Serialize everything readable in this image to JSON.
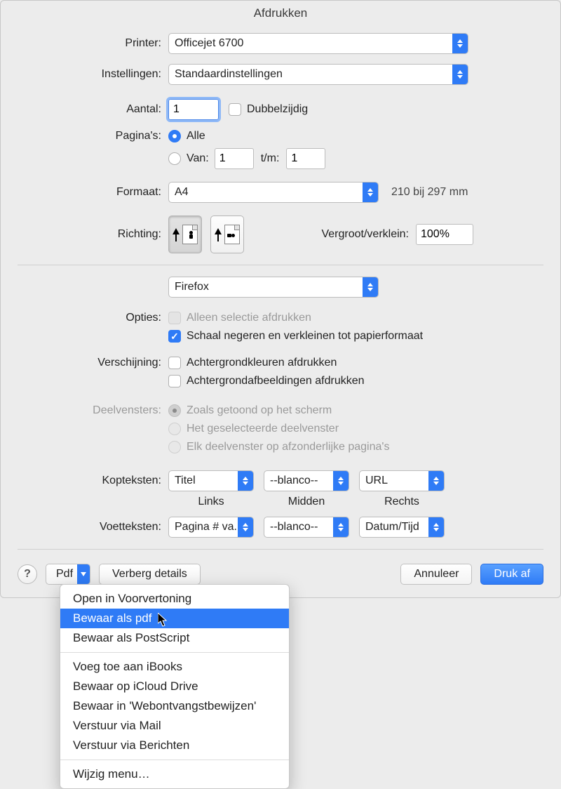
{
  "title": "Afdrukken",
  "printer": {
    "label": "Printer:",
    "value": "Officejet 6700"
  },
  "settings": {
    "label": "Instellingen:",
    "value": "Standaardinstellingen"
  },
  "copies": {
    "label": "Aantal:",
    "value": "1",
    "duplex_label": "Dubbelzijdig",
    "duplex_checked": false
  },
  "pages": {
    "label": "Pagina's:",
    "all_label": "Alle",
    "from_label": "Van:",
    "from_value": "1",
    "to_label": "t/m:",
    "to_value": "1",
    "selected": "all"
  },
  "format": {
    "label": "Formaat:",
    "value": "A4",
    "size_text": "210 bij 297 mm"
  },
  "orientation": {
    "label": "Richting:"
  },
  "scale": {
    "label": "Vergroot/verklein:",
    "value": "100%"
  },
  "app_popup": {
    "value": "Firefox"
  },
  "options": {
    "label": "Opties:",
    "selection_only": "Alleen selectie afdrukken",
    "ignore_scale": "Schaal negeren en verkleinen tot papierformaat"
  },
  "appearance": {
    "label": "Verschijning:",
    "bg_colors": "Achtergrondkleuren afdrukken",
    "bg_images": "Achtergrondafbeeldingen afdrukken"
  },
  "panes": {
    "label": "Deelvensters:",
    "as_shown": "Zoals getoond op het scherm",
    "selected_pane": "Het geselecteerde deelvenster",
    "each_pane": "Elk deelvenster op afzonderlijke pagina's"
  },
  "headers": {
    "label": "Kopteksten:",
    "left_value": "Titel",
    "center_value": "--blanco--",
    "right_value": "URL",
    "left_caption": "Links",
    "center_caption": "Midden",
    "right_caption": "Rechts"
  },
  "footers": {
    "label": "Voetteksten:",
    "left_value": "Pagina # va...",
    "center_value": "--blanco--",
    "right_value": "Datum/Tijd"
  },
  "bottom": {
    "help": "?",
    "pdf_label": "Pdf",
    "hide_details": "Verberg details",
    "cancel": "Annuleer",
    "print": "Druk af"
  },
  "pdf_menu": {
    "open_preview": "Open in Voorvertoning",
    "save_pdf": "Bewaar als pdf",
    "save_ps": "Bewaar als PostScript",
    "add_ibooks": "Voeg toe aan iBooks",
    "save_icloud": "Bewaar op iCloud Drive",
    "save_webreceipts": "Bewaar in 'Webontvangstbewijzen'",
    "send_mail": "Verstuur via Mail",
    "send_messages": "Verstuur via Berichten",
    "edit_menu": "Wijzig menu…"
  }
}
